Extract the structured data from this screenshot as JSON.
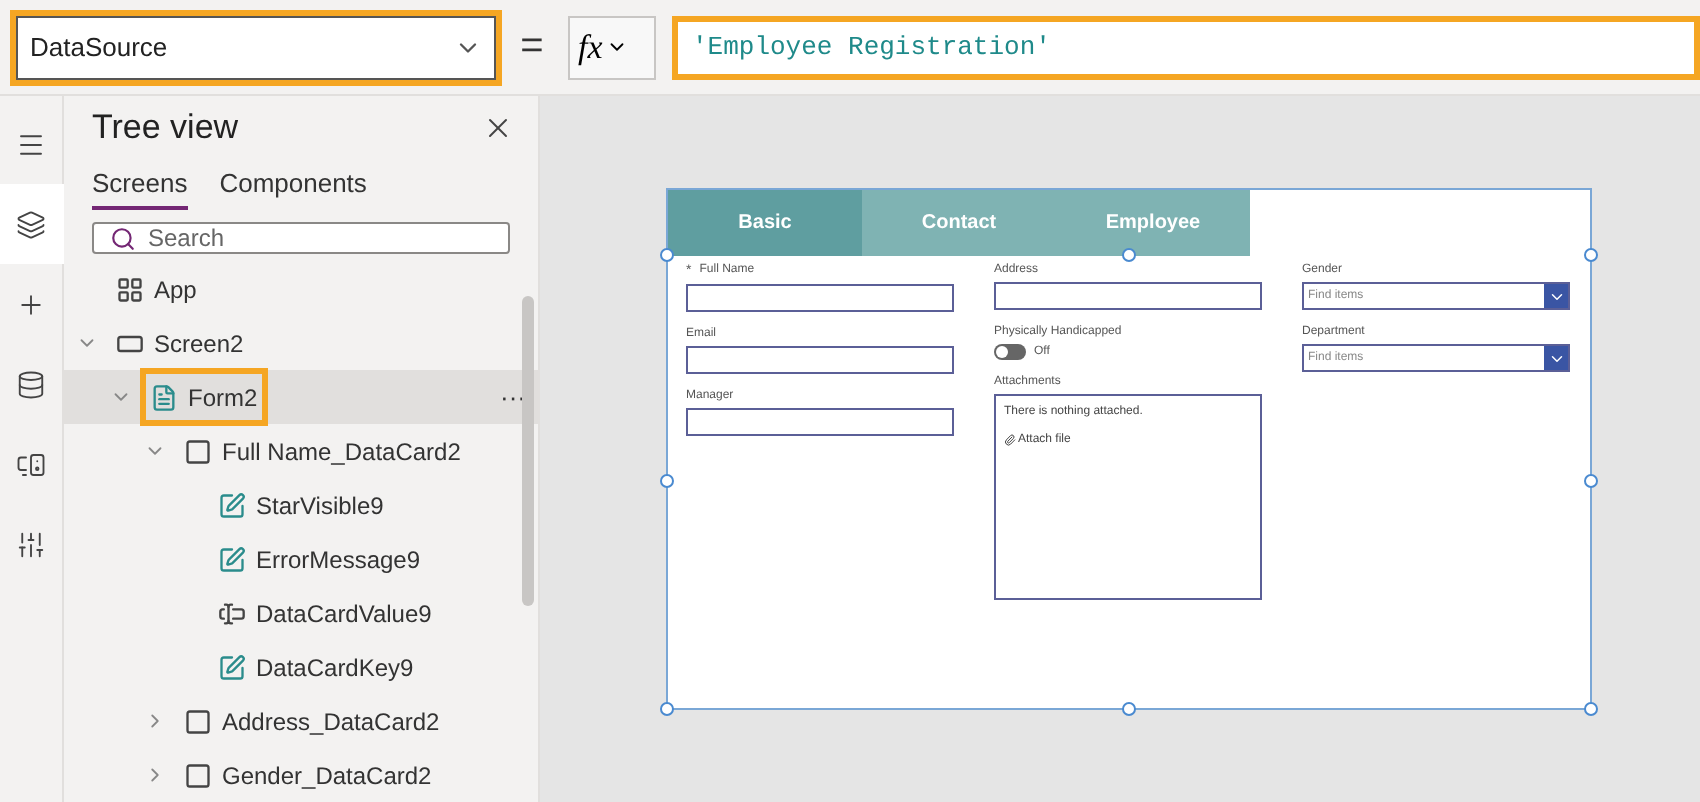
{
  "formula_bar": {
    "property": {
      "value": "DataSource",
      "highlighted": true
    },
    "equals": "=",
    "fx": "fx",
    "formula": {
      "value": "'Employee Registration'",
      "highlighted": true
    }
  },
  "rail": [
    {
      "selected": false
    },
    {
      "selected": true
    },
    {
      "selected": false
    },
    {
      "selected": false
    },
    {
      "selected": false
    },
    {
      "selected": false
    }
  ],
  "tree_view": {
    "title": "Tree view",
    "tabs": [
      {
        "label": "Screens",
        "selected": true
      },
      {
        "label": "Components",
        "selected": false
      }
    ],
    "search": {
      "placeholder": "Search"
    },
    "items": [
      {
        "label": "App",
        "kind": "app",
        "selected": false,
        "highlighted": false
      },
      {
        "label": "Screen2",
        "kind": "screen",
        "expanded": true,
        "selected": false,
        "highlighted": false,
        "children": [
          {
            "label": "Form2",
            "kind": "form",
            "expanded": true,
            "selected": true,
            "highlighted": true,
            "more": "···",
            "children": [
              {
                "label": "Full Name_DataCard2",
                "kind": "card",
                "expanded": true,
                "selected": false,
                "highlighted": false,
                "children": [
                  {
                    "label": "StarVisible9",
                    "kind": "label",
                    "selected": false,
                    "highlighted": false
                  },
                  {
                    "label": "ErrorMessage9",
                    "kind": "label",
                    "selected": false,
                    "highlighted": false
                  },
                  {
                    "label": "DataCardValue9",
                    "kind": "input",
                    "selected": false,
                    "highlighted": false
                  },
                  {
                    "label": "DataCardKey9",
                    "kind": "label",
                    "selected": false,
                    "highlighted": false
                  }
                ]
              },
              {
                "label": "Address_DataCard2",
                "kind": "card",
                "expanded": false,
                "selected": false,
                "highlighted": false
              },
              {
                "label": "Gender_DataCard2",
                "kind": "card",
                "expanded": false,
                "selected": false,
                "highlighted": false
              }
            ]
          }
        ]
      }
    ]
  },
  "form": {
    "tabs": [
      {
        "label": "Basic",
        "selected": true
      },
      {
        "label": "Contact",
        "selected": false
      },
      {
        "label": "Employee",
        "selected": false
      }
    ],
    "columns": [
      [
        {
          "kind": "text",
          "label": "Full Name",
          "required_mark": "*"
        },
        {
          "kind": "text",
          "label": "Email"
        },
        {
          "kind": "text",
          "label": "Manager"
        }
      ],
      [
        {
          "kind": "text",
          "label": "Address"
        },
        {
          "kind": "toggle",
          "label": "Physically Handicapped",
          "on": false,
          "state_text": "Off"
        },
        {
          "kind": "attachments",
          "label": "Attachments",
          "empty_text": "There is nothing attached.",
          "attach_text": "Attach file"
        }
      ],
      [
        {
          "kind": "dropdown",
          "label": "Gender",
          "placeholder": "Find items"
        },
        {
          "kind": "dropdown",
          "label": "Department",
          "placeholder": "Find items"
        }
      ]
    ]
  }
}
